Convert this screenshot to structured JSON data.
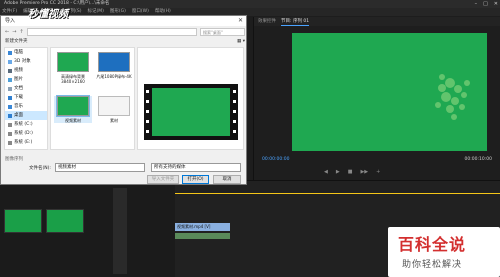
{
  "app": {
    "title": "Adobe Premiere Pro CC 2018 - C:\\用户\\...\\未命名",
    "menu": [
      "文件(F)",
      "编辑(E)",
      "剪辑(C)",
      "序列(S)",
      "标记(M)",
      "图形(G)",
      "窗口(W)",
      "帮助(H)"
    ]
  },
  "program": {
    "tabs": [
      "效果控件",
      "节目: 序列 01"
    ],
    "timecode_left": "00:00:00:00",
    "timecode_right": "00:00:10:00",
    "controls": [
      "◀",
      "▶",
      "■",
      "▶▶",
      "+"
    ]
  },
  "dialog": {
    "title": "导入",
    "search_placeholder": "搜索\"桌面\"",
    "toolbar_left": "新建文件夹",
    "nav_items": [
      {
        "label": "电脑",
        "icon": "computer-icon"
      },
      {
        "label": "3D 对象",
        "icon": "cube-icon"
      },
      {
        "label": "视频",
        "icon": "video-icon"
      },
      {
        "label": "图片",
        "icon": "picture-icon"
      },
      {
        "label": "文档",
        "icon": "document-icon"
      },
      {
        "label": "下载",
        "icon": "download-icon"
      },
      {
        "label": "音乐",
        "icon": "music-icon"
      },
      {
        "label": "桌面",
        "icon": "desktop-icon",
        "selected": true
      },
      {
        "label": "系统 (C:)",
        "icon": "drive-icon"
      },
      {
        "label": "系统 (D:)",
        "icon": "drive-icon"
      },
      {
        "label": "系统 (E:)",
        "icon": "drive-icon"
      }
    ],
    "files": [
      {
        "label": "高清绿布背景 3840×2160"
      },
      {
        "label": "片尾1080P绿布-4K"
      },
      {
        "label": "视频素材",
        "selected": true
      },
      {
        "label": "素材"
      }
    ],
    "bottom_label": "图像序列",
    "filename_label": "文件名(N):",
    "filename_value": "视频素材",
    "filetype_value": "所有支持的媒体",
    "import_folder_label": "导入文件夹",
    "open_label": "打开(O)",
    "cancel_label": "取消"
  },
  "watermarks": {
    "top_left": "秒懂视频",
    "bottom_right_main": "百科全说",
    "bottom_right_sub": "助你轻松解决"
  },
  "timeline": {
    "clip_label": "视频素材.mp4 [V]"
  },
  "colors": {
    "green_screen": "#1fa851",
    "accent_blue": "#4aa3ff"
  }
}
